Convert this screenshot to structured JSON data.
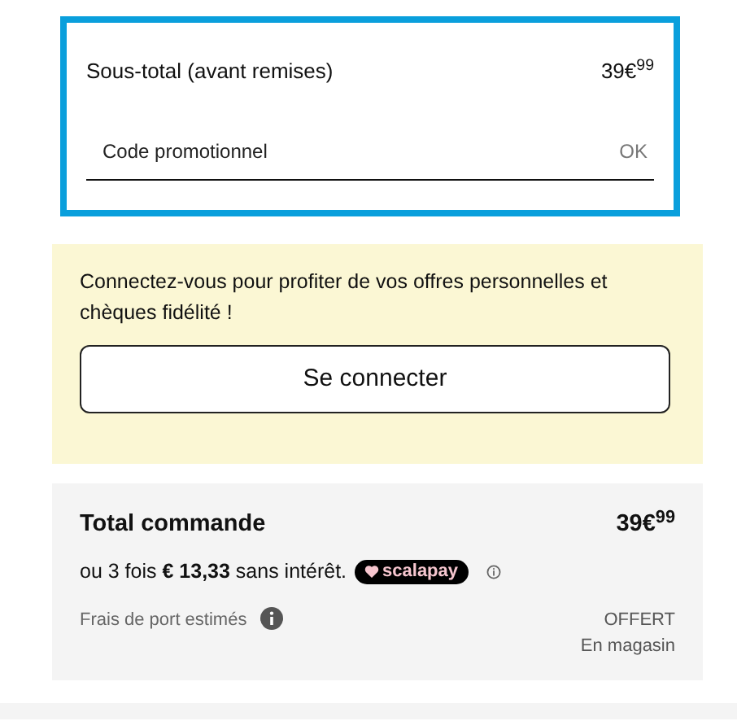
{
  "subtotal": {
    "label": "Sous-total (avant remises)",
    "amount": "39€$^{99}$"
  },
  "promo": {
    "placeholder": "Code promotionnel",
    "button": "OK"
  },
  "login": {
    "message": "Connectez-vous pour profiter de vos offres personnelles et chèques fidélité !",
    "button": "Se connecter"
  },
  "total": {
    "label": "Total commande",
    "amount": "39€$^{99}$",
    "installments": "ou 3 fois **€ 13,33** sans intérêt.",
    "provider": "scalapay",
    "shipping_label": "Frais de port estimés",
    "shipping_value": "OFFERT",
    "shipping_mode": "En magasin"
  }
}
